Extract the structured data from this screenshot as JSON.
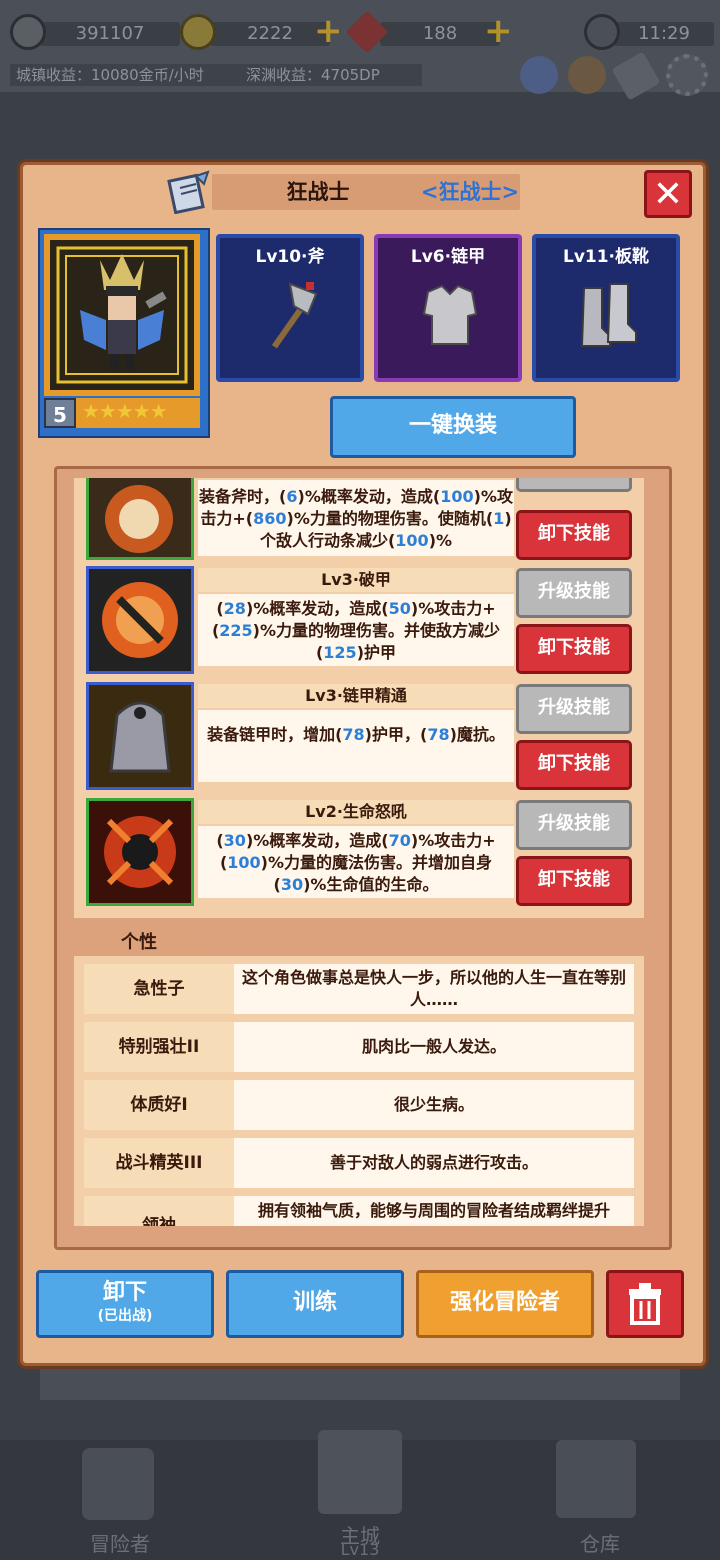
{
  "status": {
    "currency1": "391107",
    "coins": "2222",
    "gems": "188",
    "time": "11:29",
    "town_income": "城镇收益：10080金币/小时",
    "abyss_income": "深渊收益：4705DP"
  },
  "hero": {
    "name": "狂战士",
    "class": "<狂战士>",
    "level_badge": "5",
    "stars": "★★★★★"
  },
  "equipment": [
    {
      "label": "Lv10·斧",
      "icon": "axe-icon"
    },
    {
      "label": "Lv6·链甲",
      "icon": "chainmail-icon"
    },
    {
      "label": "Lv11·板靴",
      "icon": "boots-icon"
    }
  ],
  "equip_all_label": "一键换装",
  "skills": [
    {
      "name": "",
      "desc": [
        "装备斧时，(",
        "6",
        ")%概率发动，造成(",
        "100",
        ")%攻击力+(",
        "860",
        ")%力量的物理伤害。使随机(",
        "1",
        ")个敌人行动条减少(",
        "100",
        ")%"
      ],
      "upgrade_label": "",
      "remove_label": "卸下技能"
    },
    {
      "name": "Lv3·破甲",
      "desc": [
        "(",
        "28",
        ")%概率发动，造成(",
        "50",
        ")%攻击力+(",
        "225",
        ")%力量的物理伤害。并使敌方减少(",
        "125",
        ")护甲"
      ],
      "upgrade_label": "升级技能",
      "remove_label": "卸下技能"
    },
    {
      "name": "Lv3·链甲精通",
      "desc": [
        "装备链甲时，增加(",
        "78",
        ")护甲，(",
        "78",
        ")魔抗。"
      ],
      "upgrade_label": "升级技能",
      "remove_label": "卸下技能"
    },
    {
      "name": "Lv2·生命怒吼",
      "desc": [
        "(",
        "30",
        ")%概率发动，造成(",
        "70",
        ")%攻击力+(",
        "100",
        ")%力量的魔法伤害。并增加自身(",
        "30",
        ")%生命值的生命。"
      ],
      "upgrade_label": "升级技能",
      "remove_label": "卸下技能"
    }
  ],
  "personality_tab": "个性",
  "traits": [
    {
      "name": "急性子",
      "desc": "这个角色做事总是快人一步，所以他的人生一直在等别人……"
    },
    {
      "name": "特别强壮II",
      "desc": "肌肉比一般人发达。"
    },
    {
      "name": "体质好I",
      "desc": "很少生病。"
    },
    {
      "name": "战斗精英III",
      "desc": "善于对敌人的弱点进行攻击。"
    },
    {
      "name": "领袖",
      "desc": "拥有领袖气质，能够与周围的冒险者结成羁绊提升"
    }
  ],
  "actions": {
    "unequip_label": "卸下",
    "unequip_sub": "(已出战)",
    "train_label": "训练",
    "enhance_label": "强化冒险者",
    "delete_icon": "trash-icon"
  },
  "nav": {
    "adventurers": "冒险者",
    "main_city": "主城",
    "main_city_level": "Lv13",
    "warehouse": "仓库"
  },
  "colors": {
    "number_blue": "#2d7fd6",
    "red_button": "#d8343a",
    "blue_button": "#51a8e8",
    "orange_button": "#f0a030"
  }
}
